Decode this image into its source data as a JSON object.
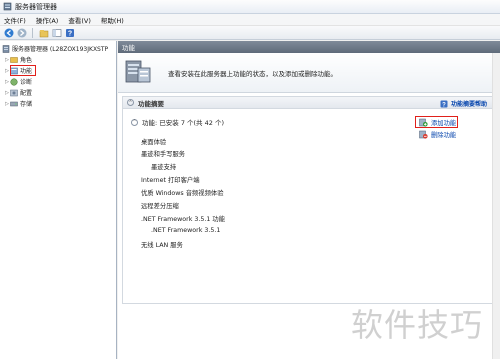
{
  "window": {
    "title": "服务器管理器"
  },
  "menu": [
    {
      "label": "文件(F)"
    },
    {
      "label": "操作(A)"
    },
    {
      "label": "查看(V)"
    },
    {
      "label": "帮助(H)"
    }
  ],
  "tree": {
    "root": "服务器管理器 (L28ZOX193JKXSTP",
    "items": [
      {
        "label": "角色"
      },
      {
        "label": "功能"
      },
      {
        "label": "诊断"
      },
      {
        "label": "配置"
      },
      {
        "label": "存储"
      }
    ]
  },
  "main": {
    "header": "功能",
    "banner_text": "查看安装在此服务器上功能的状态，以及添加或删除功能。",
    "section_title": "功能摘要",
    "help_link": "功能摘要帮助",
    "installed_summary": "功能: 已安装 7 个(共 42 个)",
    "features": [
      "桌面体验",
      "墨迹和手写服务",
      "墨迹支持",
      "Internet 打印客户端",
      "优质 Windows 音频视频体验",
      "远程差分压缩",
      ".NET Framework 3.5.1 功能",
      ".NET Framework 3.5.1",
      "无线 LAN 服务"
    ],
    "add_link": "添加功能",
    "remove_link": "删除功能"
  },
  "watermark": "软件技巧",
  "colors": {
    "highlight_box": "#e0201b",
    "link": "#0645ad",
    "header": "#6f7a89"
  }
}
